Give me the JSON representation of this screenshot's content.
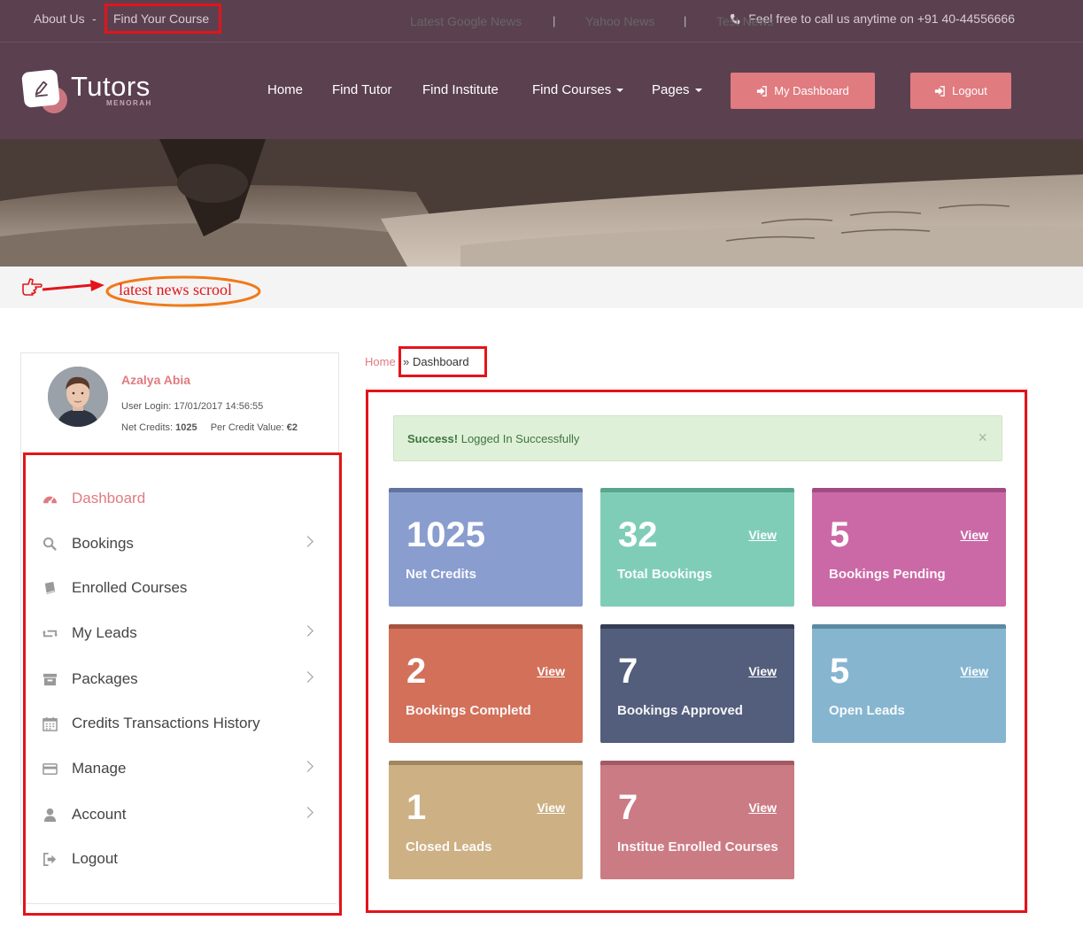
{
  "topbar": {
    "about": "About Us",
    "separator": "-",
    "find_course": "Find Your Course",
    "phone_text": "Feel free to call us anytime on +91 40-44556666"
  },
  "logo": {
    "brand": "Tutors",
    "sub": "MENORAH"
  },
  "nav": {
    "items": [
      "Home",
      "Find Tutor",
      "Find Institute",
      "Find Courses",
      "Pages"
    ],
    "dashboard_button": "My Dashboard",
    "logout_button": "Logout"
  },
  "news": {
    "annotation": "latest news scrool",
    "items": [
      "Latest Google News",
      "Yahoo News",
      "Test News"
    ],
    "separator": "|"
  },
  "profile": {
    "name": "Azalya Abia",
    "login_label": "User Login:",
    "login_value": "17/01/2017 14:56:55",
    "credits_label": "Net Credits:",
    "credits_value": "1025",
    "per_credit_label": "Per Credit Value:",
    "per_credit_value": "€2"
  },
  "sidebar": {
    "items": [
      {
        "label": "Dashboard",
        "icon": "dashboard-icon"
      },
      {
        "label": "Bookings",
        "icon": "search-icon"
      },
      {
        "label": "Enrolled Courses",
        "icon": "book-icon"
      },
      {
        "label": "My Leads",
        "icon": "retweet-icon"
      },
      {
        "label": "Packages",
        "icon": "archive-icon"
      },
      {
        "label": "Credits Transactions History",
        "icon": "calendar-icon"
      },
      {
        "label": "Manage",
        "icon": "credit-card-icon"
      },
      {
        "label": "Account",
        "icon": "user-icon"
      },
      {
        "label": "Logout",
        "icon": "sign-out-icon"
      }
    ]
  },
  "breadcrumb": {
    "home": "Home",
    "separator": "»",
    "current": "Dashboard"
  },
  "alert": {
    "strong": "Success!",
    "message": "Logged In Successfully",
    "close": "×"
  },
  "cards": [
    {
      "value": "1025",
      "label": "Net Credits",
      "view": "",
      "color": "#8a9dcf",
      "top_color": "#63739f"
    },
    {
      "value": "32",
      "label": "Total Bookings",
      "view": "View",
      "color": "#80cdb7",
      "top_color": "#5aa58d"
    },
    {
      "value": "5",
      "label": "Bookings Pending",
      "view": "View",
      "color": "#cb69a6",
      "top_color": "#a04c82"
    },
    {
      "value": "2",
      "label": "Bookings Completd",
      "view": "View",
      "color": "#d2705a",
      "top_color": "#a4543f"
    },
    {
      "value": "7",
      "label": "Bookings Approved",
      "view": "View",
      "color": "#535d7c",
      "top_color": "#363d55"
    },
    {
      "value": "5",
      "label": "Open Leads",
      "view": "View",
      "color": "#86b5d0",
      "top_color": "#5d8aa3"
    },
    {
      "value": "1",
      "label": "Closed Leads",
      "view": "View",
      "color": "#cdb084",
      "top_color": "#a08660"
    },
    {
      "value": "7",
      "label": "Institue Enrolled Courses",
      "view": "View",
      "color": "#cb7b84",
      "top_color": "#a25a63"
    }
  ],
  "colors": {
    "header_bg": "#5b4050",
    "accent": "#e07b80",
    "annotation_red": "#e3141a",
    "annotation_orange": "#f07a18"
  }
}
